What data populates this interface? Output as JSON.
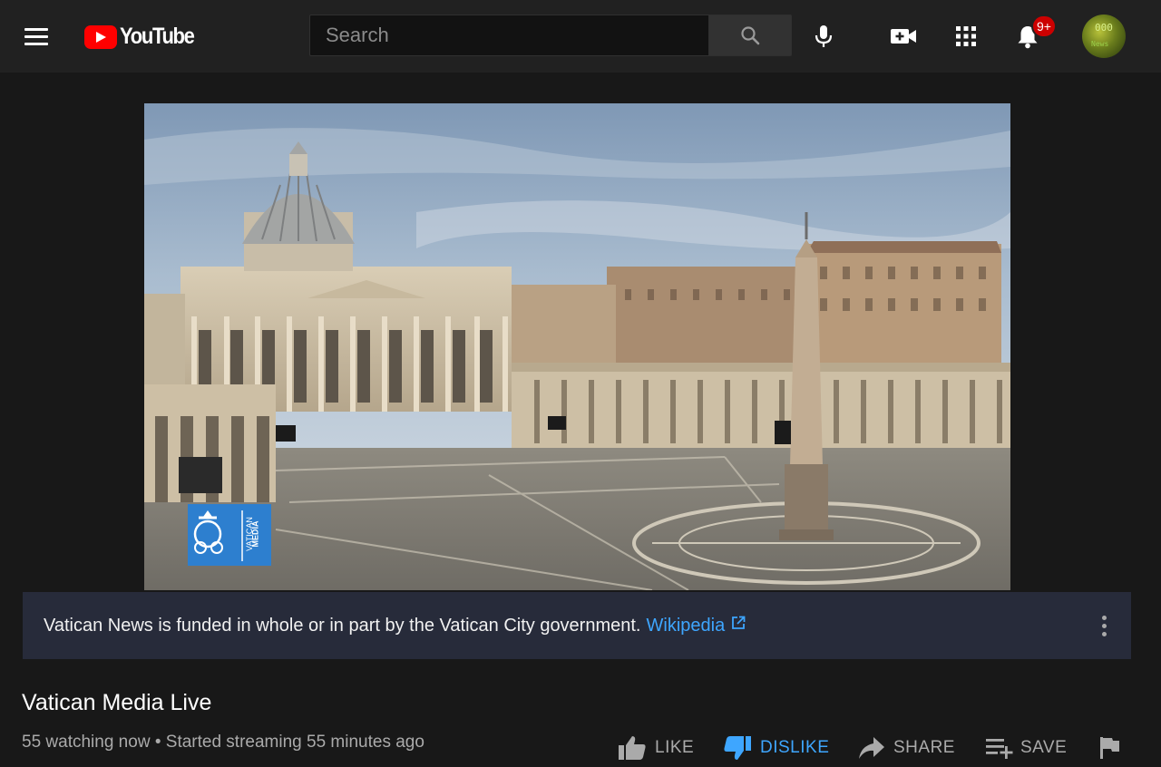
{
  "header": {
    "logo_text": "YouTube",
    "search_placeholder": "Search",
    "notification_count": "9+",
    "avatar_text_1": "000",
    "avatar_text_2": "News"
  },
  "video": {
    "watermark_line_1": "VATICAN",
    "watermark_line_2": "MEDIA"
  },
  "info_panel": {
    "text": "Vatican News is funded in whole or in part by the Vatican City government.",
    "link_text": "Wikipedia"
  },
  "title": "Vatican Media Live",
  "meta": {
    "watching": "55 watching now",
    "separator": " • ",
    "started": "Started streaming 55 minutes ago"
  },
  "actions": {
    "like": "LIKE",
    "dislike": "DISLIKE",
    "share": "SHARE",
    "save": "SAVE"
  },
  "colors": {
    "background": "#181818",
    "topbar": "#212121",
    "accent_blue": "#3ea6ff",
    "brand_red": "#ff0000",
    "info_panel": "#272b3a"
  },
  "icons": {
    "menu": "hamburger-menu-icon",
    "search": "search-icon",
    "mic": "microphone-icon",
    "create": "video-camera-plus-icon",
    "apps": "apps-grid-icon",
    "notifications": "bell-icon",
    "external": "external-link-icon",
    "more": "more-vert-icon",
    "like": "thumbs-up-icon",
    "dislike": "thumbs-down-icon",
    "share": "share-arrow-icon",
    "save": "playlist-add-icon",
    "report": "flag-icon"
  }
}
